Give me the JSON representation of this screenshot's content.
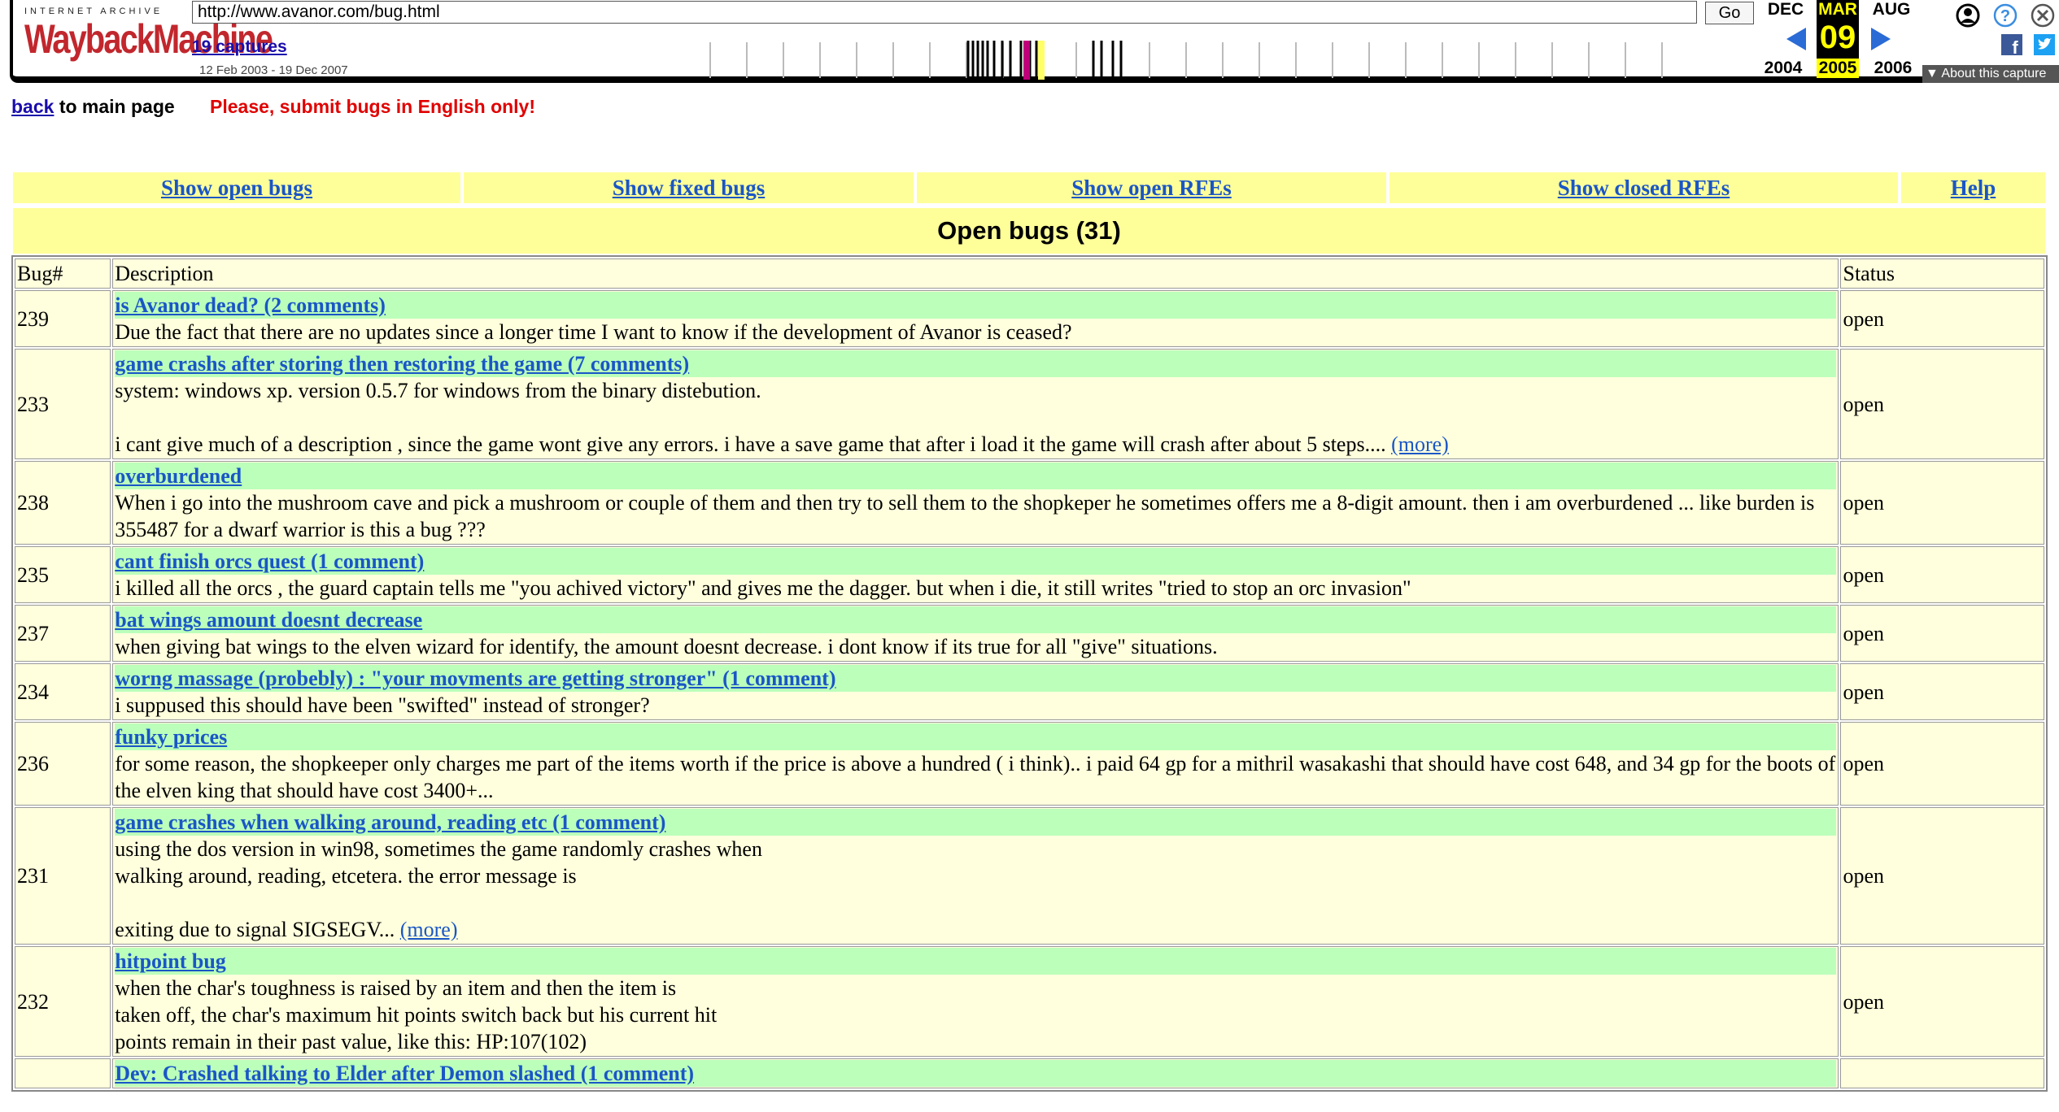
{
  "wayback": {
    "logo_top": "INTERNET ARCHIVE",
    "logo_main": "WaybackMachine",
    "url": "http://www.avanor.com/bug.html",
    "go_label": "Go",
    "captures_link": "19 captures",
    "date_range": "12 Feb 2003 - 19 Dec 2007",
    "prev_month": "DEC",
    "cur_month": "MAR",
    "next_month": "AUG",
    "cur_day": "09",
    "prev_year": "2004",
    "cur_year": "2005",
    "next_year": "2006",
    "about_label": "About this capture",
    "icons": [
      "user-icon",
      "help-icon",
      "close-icon",
      "facebook-icon",
      "twitter-icon"
    ]
  },
  "page": {
    "back_link": "back",
    "back_text": " to main page",
    "warning": "Please, submit bugs in English only!"
  },
  "nav": {
    "items": [
      "Show open bugs",
      "Show fixed bugs",
      "Show open RFEs",
      "Show closed RFEs",
      "Help"
    ]
  },
  "heading": "Open bugs (31)",
  "table": {
    "headers": {
      "id": "Bug#",
      "desc": "Description",
      "status": "Status"
    },
    "rows": [
      {
        "id": "239",
        "title": "is Avanor dead? (2 comments)",
        "body": "Due the fact that there are no updates since a longer time I want to know if the development of Avanor is ceased?",
        "more": "",
        "status": "open"
      },
      {
        "id": "233",
        "title": "game crashs after storing then restoring the game (7 comments)",
        "body": "system: windows xp. version 0.5.7 for windows from the binary distebution.\n\ni cant give much of a description , since the game wont give any errors. i have a save game that after i load it the game will crash after about 5 steps.... ",
        "more": "(more)",
        "status": "open"
      },
      {
        "id": "238",
        "title": "overburdened",
        "body": "When i go into the mushroom cave and pick a mushroom or couple of them and then try to sell them to the shopkeper he sometimes offers me a 8-digit amount. then i am overburdened ... like burden is 355487 for a dwarf warrior is this a bug ???",
        "more": "",
        "status": "open"
      },
      {
        "id": "235",
        "title": "cant finish orcs quest (1 comment)",
        "body": "i killed all the orcs , the guard captain tells me \"you achived victory\" and gives me the dagger. but when i die, it still writes \"tried to stop an orc invasion\"",
        "more": "",
        "status": "open"
      },
      {
        "id": "237",
        "title": "bat wings amount doesnt decrease",
        "body": "when giving bat wings to the elven wizard for identify, the amount doesnt decrease. i dont know if its true for all \"give\" situations.",
        "more": "",
        "status": "open"
      },
      {
        "id": "234",
        "title": "worng massage (probebly) : \"your movments are getting stronger\" (1 comment)",
        "body": "i suppused this should have been \"swifted\" instead of stronger?",
        "more": "",
        "status": "open"
      },
      {
        "id": "236",
        "title": "funky prices",
        "body": "for some reason, the shopkeeper only charges me part of the items worth if the price is above a hundred ( i think).. i paid 64 gp for a mithril wasakashi that should have cost 648, and 34 gp for the boots of the elven king that should have cost 3400+...",
        "more": "",
        "status": "open"
      },
      {
        "id": "231",
        "title": "game crashes when walking around, reading etc (1 comment)",
        "body": "using the dos version in win98, sometimes the game randomly crashes when\nwalking around, reading, etcetera. the error message is\n\nexiting due to signal SIGSEGV... ",
        "more": "(more)",
        "status": "open"
      },
      {
        "id": "232",
        "title": "hitpoint bug",
        "body": "when the char's toughness is raised by an item and then the item is\ntaken off, the char's maximum hit points switch back but his current hit\npoints remain in their past value, like this: HP:107(102)",
        "more": "",
        "status": "open"
      },
      {
        "id": "",
        "title": "Dev: Crashed talking to Elder after Demon slashed (1 comment)",
        "body": "",
        "more": "",
        "status": ""
      }
    ]
  }
}
